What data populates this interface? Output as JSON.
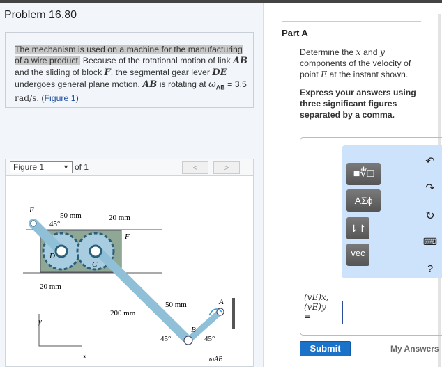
{
  "problem": {
    "title": "Problem 16.80",
    "text_highlighted": "The mechanism is used on a machine for the manufacturing of a wire product.",
    "text_1": " Because of the rotational motion of link ",
    "ab": "AB",
    "text_2": " and the sliding of block ",
    "f": "F",
    "text_3": ", the segmental gear lever ",
    "de": "DE",
    "text_4": " undergoes general plane motion. ",
    "text_5": " is rotating at ",
    "omega": "ω",
    "omega_sub": "AB",
    "value": " = 3.5 ",
    "unit": "rad/s",
    "text_6": ". (",
    "figure_link": "Figure 1",
    "text_7": ")"
  },
  "figure_nav": {
    "selected": "Figure 1",
    "of": "of 1",
    "prev": "<",
    "next": ">"
  },
  "figure": {
    "labels": {
      "E": "E",
      "D": "D",
      "C": "C",
      "F": "F",
      "A": "A",
      "B": "B",
      "d50a": "50 mm",
      "d20a": "20 mm",
      "d20b": "20 mm",
      "d200": "200 mm",
      "d50b": "50 mm",
      "ang1": "45°",
      "ang2": "45°",
      "ang3": "45°",
      "y": "y",
      "x": "x",
      "omega": "ωAB"
    }
  },
  "part_a": {
    "heading": "Part A",
    "question_1": "Determine the ",
    "x": "x",
    "question_2": " and ",
    "y": "y",
    "question_3": " components of the velocity of point ",
    "e": "E",
    "question_4": " at the instant shown.",
    "instruction": "Express your answers using three significant figures separated by a comma.",
    "toolbar": {
      "templates": "■∜□",
      "greek": "ΑΣϕ",
      "updown": "⇂↾",
      "vec": "vec",
      "undo": "↶",
      "redo": "↷",
      "reset": "↻",
      "keyboard": "⌨",
      "help": "?"
    },
    "answer_label_1": "(vE)x,",
    "answer_label_2": "(vE)y",
    "answer_label_3": "=",
    "answer_value": "",
    "submit": "Submit",
    "my_answers": "My Answers"
  }
}
